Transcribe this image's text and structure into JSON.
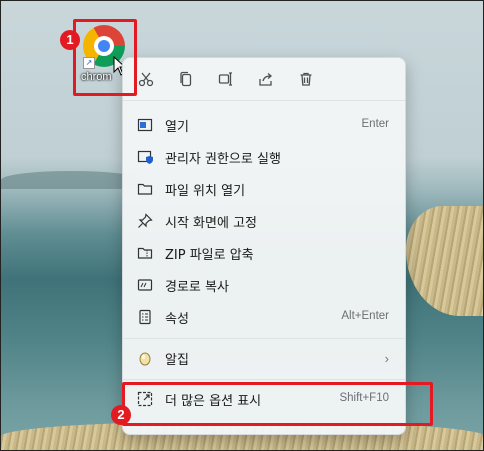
{
  "desktop": {
    "icon_label": "chrom",
    "icon_name": "chrome-icon"
  },
  "toolbar": {
    "icons": [
      "cut-icon",
      "copy-icon",
      "rename-icon",
      "share-icon",
      "delete-icon"
    ]
  },
  "menu": {
    "items": [
      {
        "label": "열기",
        "shortcut": "Enter",
        "icon": "open-icon"
      },
      {
        "label": "관리자 권한으로 실행",
        "shortcut": "",
        "icon": "shield-icon"
      },
      {
        "label": "파일 위치 열기",
        "shortcut": "",
        "icon": "folder-icon"
      },
      {
        "label": "시작 화면에 고정",
        "shortcut": "",
        "icon": "pin-icon"
      },
      {
        "label": "ZIP 파일로 압축",
        "shortcut": "",
        "icon": "zip-icon"
      },
      {
        "label": "경로로 복사",
        "shortcut": "",
        "icon": "copy-path-icon"
      },
      {
        "label": "속성",
        "shortcut": "Alt+Enter",
        "icon": "properties-icon"
      },
      {
        "label": "알집",
        "shortcut": "",
        "icon": "alzip-icon"
      },
      {
        "label": "더 많은 옵션 표시",
        "shortcut": "Shift+F10",
        "icon": "more-options-icon"
      }
    ]
  },
  "annotations": {
    "badge1": "1",
    "badge2": "2",
    "color": "#e21b23"
  }
}
